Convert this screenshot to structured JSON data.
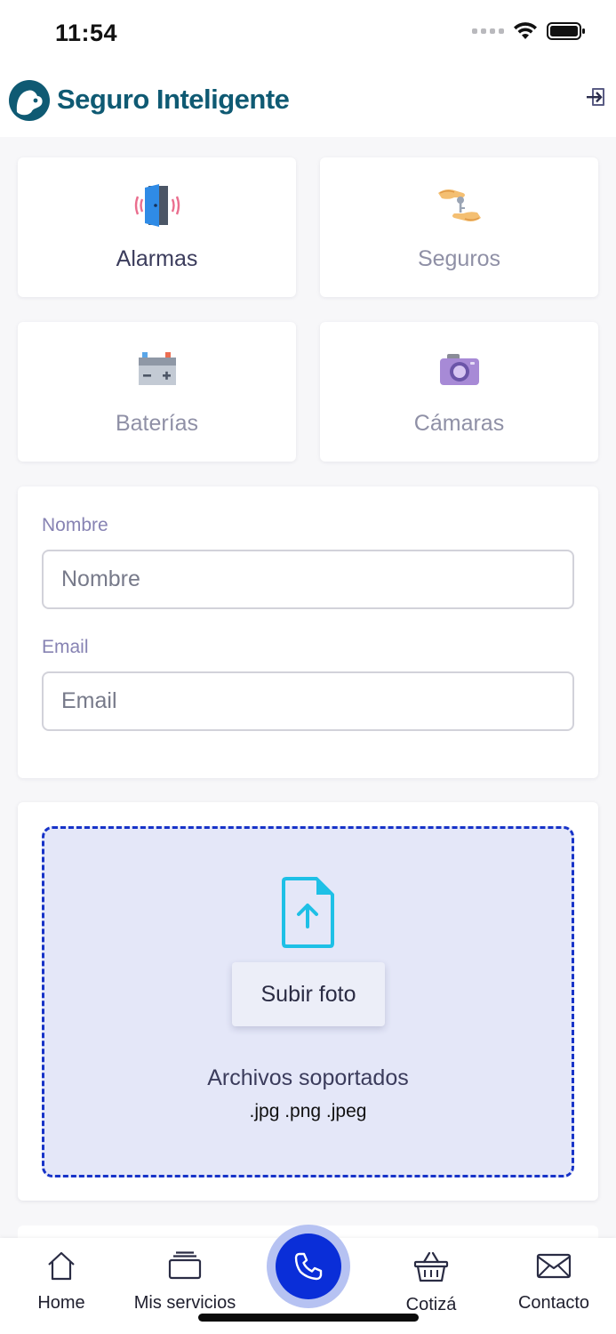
{
  "status_bar": {
    "time": "11:54"
  },
  "header": {
    "brand": "Seguro Inteligente"
  },
  "services": [
    {
      "label": "Alarmas",
      "icon": "door-alarm-icon",
      "active": true
    },
    {
      "label": "Seguros",
      "icon": "hand-key-icon",
      "active": false
    },
    {
      "label": "Baterías",
      "icon": "battery-icon",
      "active": false
    },
    {
      "label": "Cámaras",
      "icon": "camera-icon",
      "active": false
    }
  ],
  "form": {
    "name_label": "Nombre",
    "name_placeholder": "Nombre",
    "name_value": "",
    "email_label": "Email",
    "email_placeholder": "Email",
    "email_value": ""
  },
  "upload": {
    "button_label": "Subir foto",
    "supported_title": "Archivos soportados",
    "supported_extensions": ".jpg .png .jpeg"
  },
  "bottom_nav": {
    "home": "Home",
    "services": "Mis servicios",
    "quote": "Cotizá",
    "contact": "Contacto"
  },
  "colors": {
    "accent": "#0a2ed8",
    "brand": "#0f5a73",
    "dropzone_bg": "#e4e7f8",
    "label": "#8783b3"
  }
}
